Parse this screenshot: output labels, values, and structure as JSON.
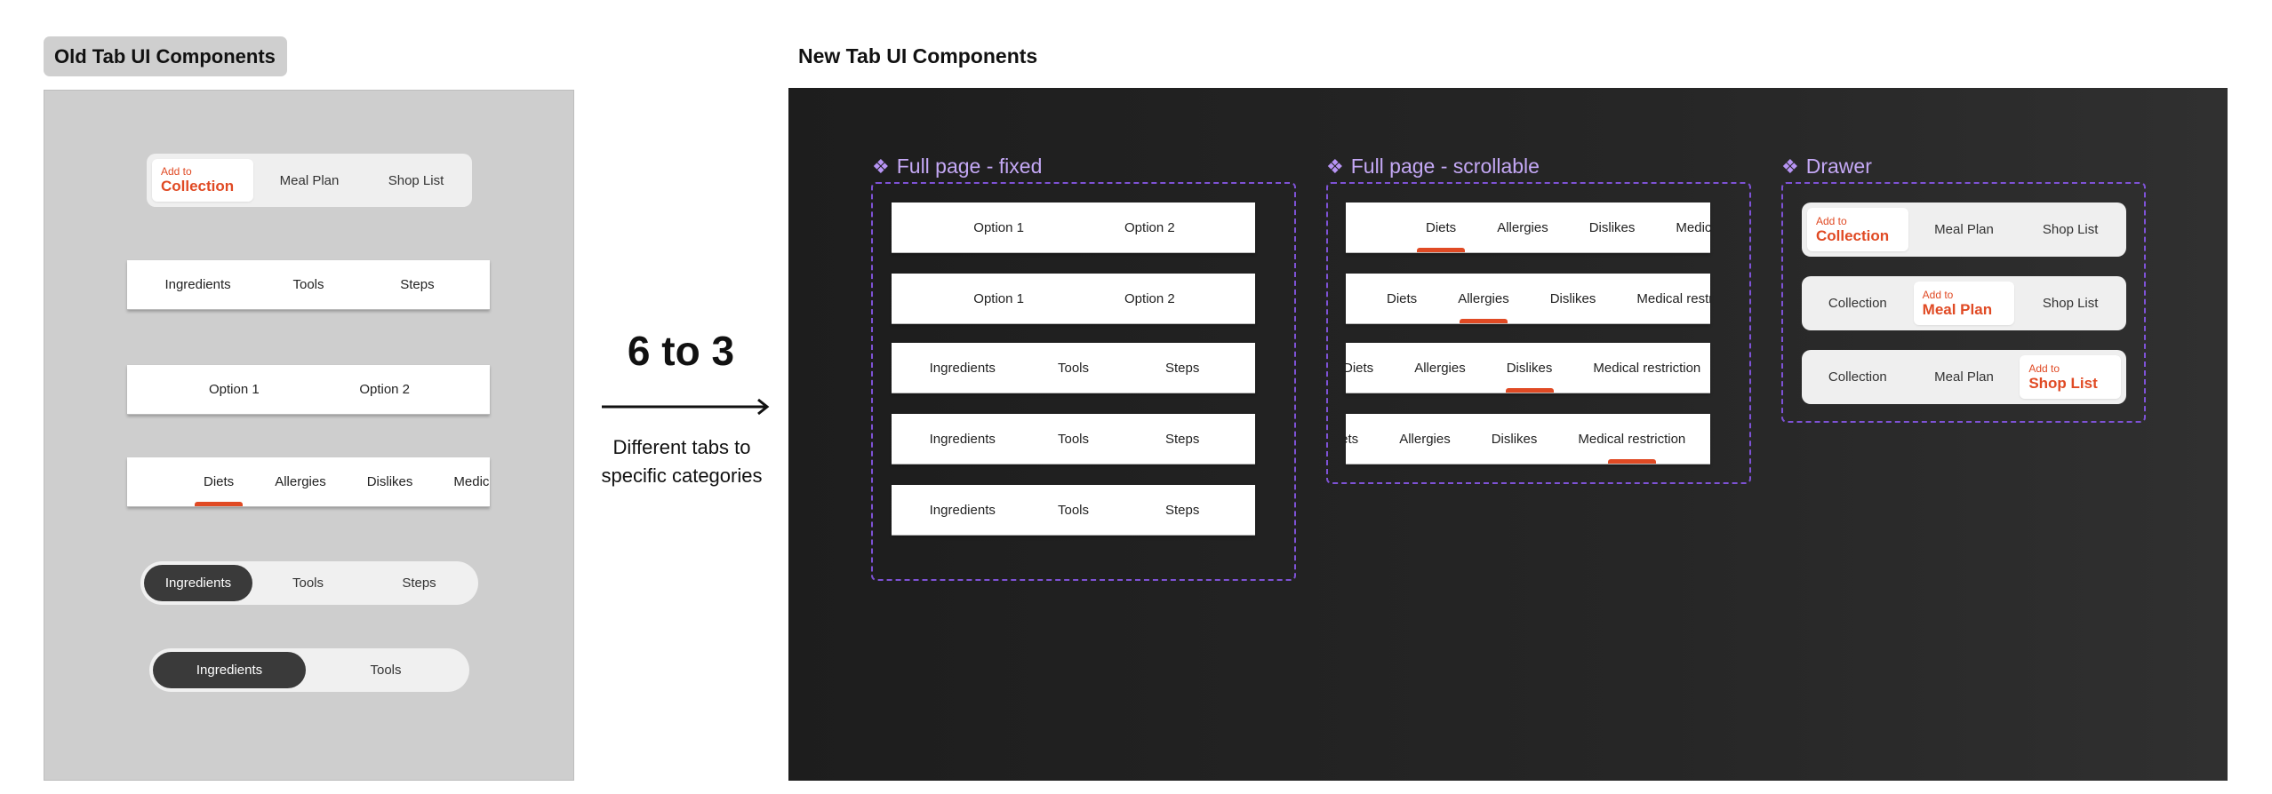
{
  "old_section": {
    "title": "Old Tab UI Components",
    "add_card": {
      "prefix": "Add to",
      "items": [
        "Collection",
        "Meal Plan",
        "Shop List"
      ],
      "active": 0
    },
    "bars": [
      {
        "kind": "fixed",
        "items": [
          "Ingredients",
          "Tools",
          "Steps"
        ],
        "active": 0
      },
      {
        "kind": "fixed",
        "items": [
          "Option 1",
          "Option 2"
        ],
        "active": 0
      },
      {
        "kind": "scroll",
        "items": [
          "Diets",
          "Allergies",
          "Dislikes",
          "Medical restriction"
        ],
        "active": 0
      }
    ],
    "pills": [
      {
        "items": [
          "Ingredients",
          "Tools",
          "Steps"
        ],
        "active": 0
      },
      {
        "items": [
          "Ingredients",
          "Tools"
        ],
        "active": 0
      }
    ]
  },
  "transition": {
    "ratio": "6 to 3",
    "description_line1": "Different tabs to",
    "description_line2": "specific categories",
    "arrow_icon": "arrow-right-icon"
  },
  "new_section": {
    "title": "New Tab UI Components",
    "groups": [
      {
        "label": "Full page - fixed",
        "icon": "component-icon",
        "bars": [
          {
            "items": [
              "Option 1",
              "Option 2"
            ],
            "active": 0
          },
          {
            "items": [
              "Option 1",
              "Option 2"
            ],
            "active": 1
          },
          {
            "items": [
              "Ingredients",
              "Tools",
              "Steps"
            ],
            "active": 0
          },
          {
            "items": [
              "Ingredients",
              "Tools",
              "Steps"
            ],
            "active": 1
          },
          {
            "items": [
              "Ingredients",
              "Tools",
              "Steps"
            ],
            "active": 2
          }
        ]
      },
      {
        "label": "Full page - scrollable",
        "icon": "component-icon",
        "bars": [
          {
            "items": [
              "Diets",
              "Allergies",
              "Dislikes",
              "Medical restriction"
            ],
            "active": 0
          },
          {
            "items": [
              "Diets",
              "Allergies",
              "Dislikes",
              "Medical restriction"
            ],
            "active": 1
          },
          {
            "items": [
              "Diets",
              "Allergies",
              "Dislikes",
              "Medical restriction"
            ],
            "active": 2
          },
          {
            "items": [
              "Diets",
              "Allergies",
              "Dislikes",
              "Medical restriction"
            ],
            "active": 3
          }
        ]
      },
      {
        "label": "Drawer",
        "icon": "component-icon",
        "cards": [
          {
            "prefix": "Add to",
            "items": [
              "Collection",
              "Meal Plan",
              "Shop List"
            ],
            "active": 0
          },
          {
            "prefix": "Add to",
            "items": [
              "Collection",
              "Meal Plan",
              "Shop List"
            ],
            "active": 1
          },
          {
            "prefix": "Add to",
            "items": [
              "Collection",
              "Meal Plan",
              "Shop List"
            ],
            "active": 2
          }
        ]
      }
    ]
  },
  "colors": {
    "accent": "#e04a24",
    "group_label": "#c4a8f5",
    "dashed_border": "#7e52d6",
    "active_pill": "#3a3a3a"
  }
}
